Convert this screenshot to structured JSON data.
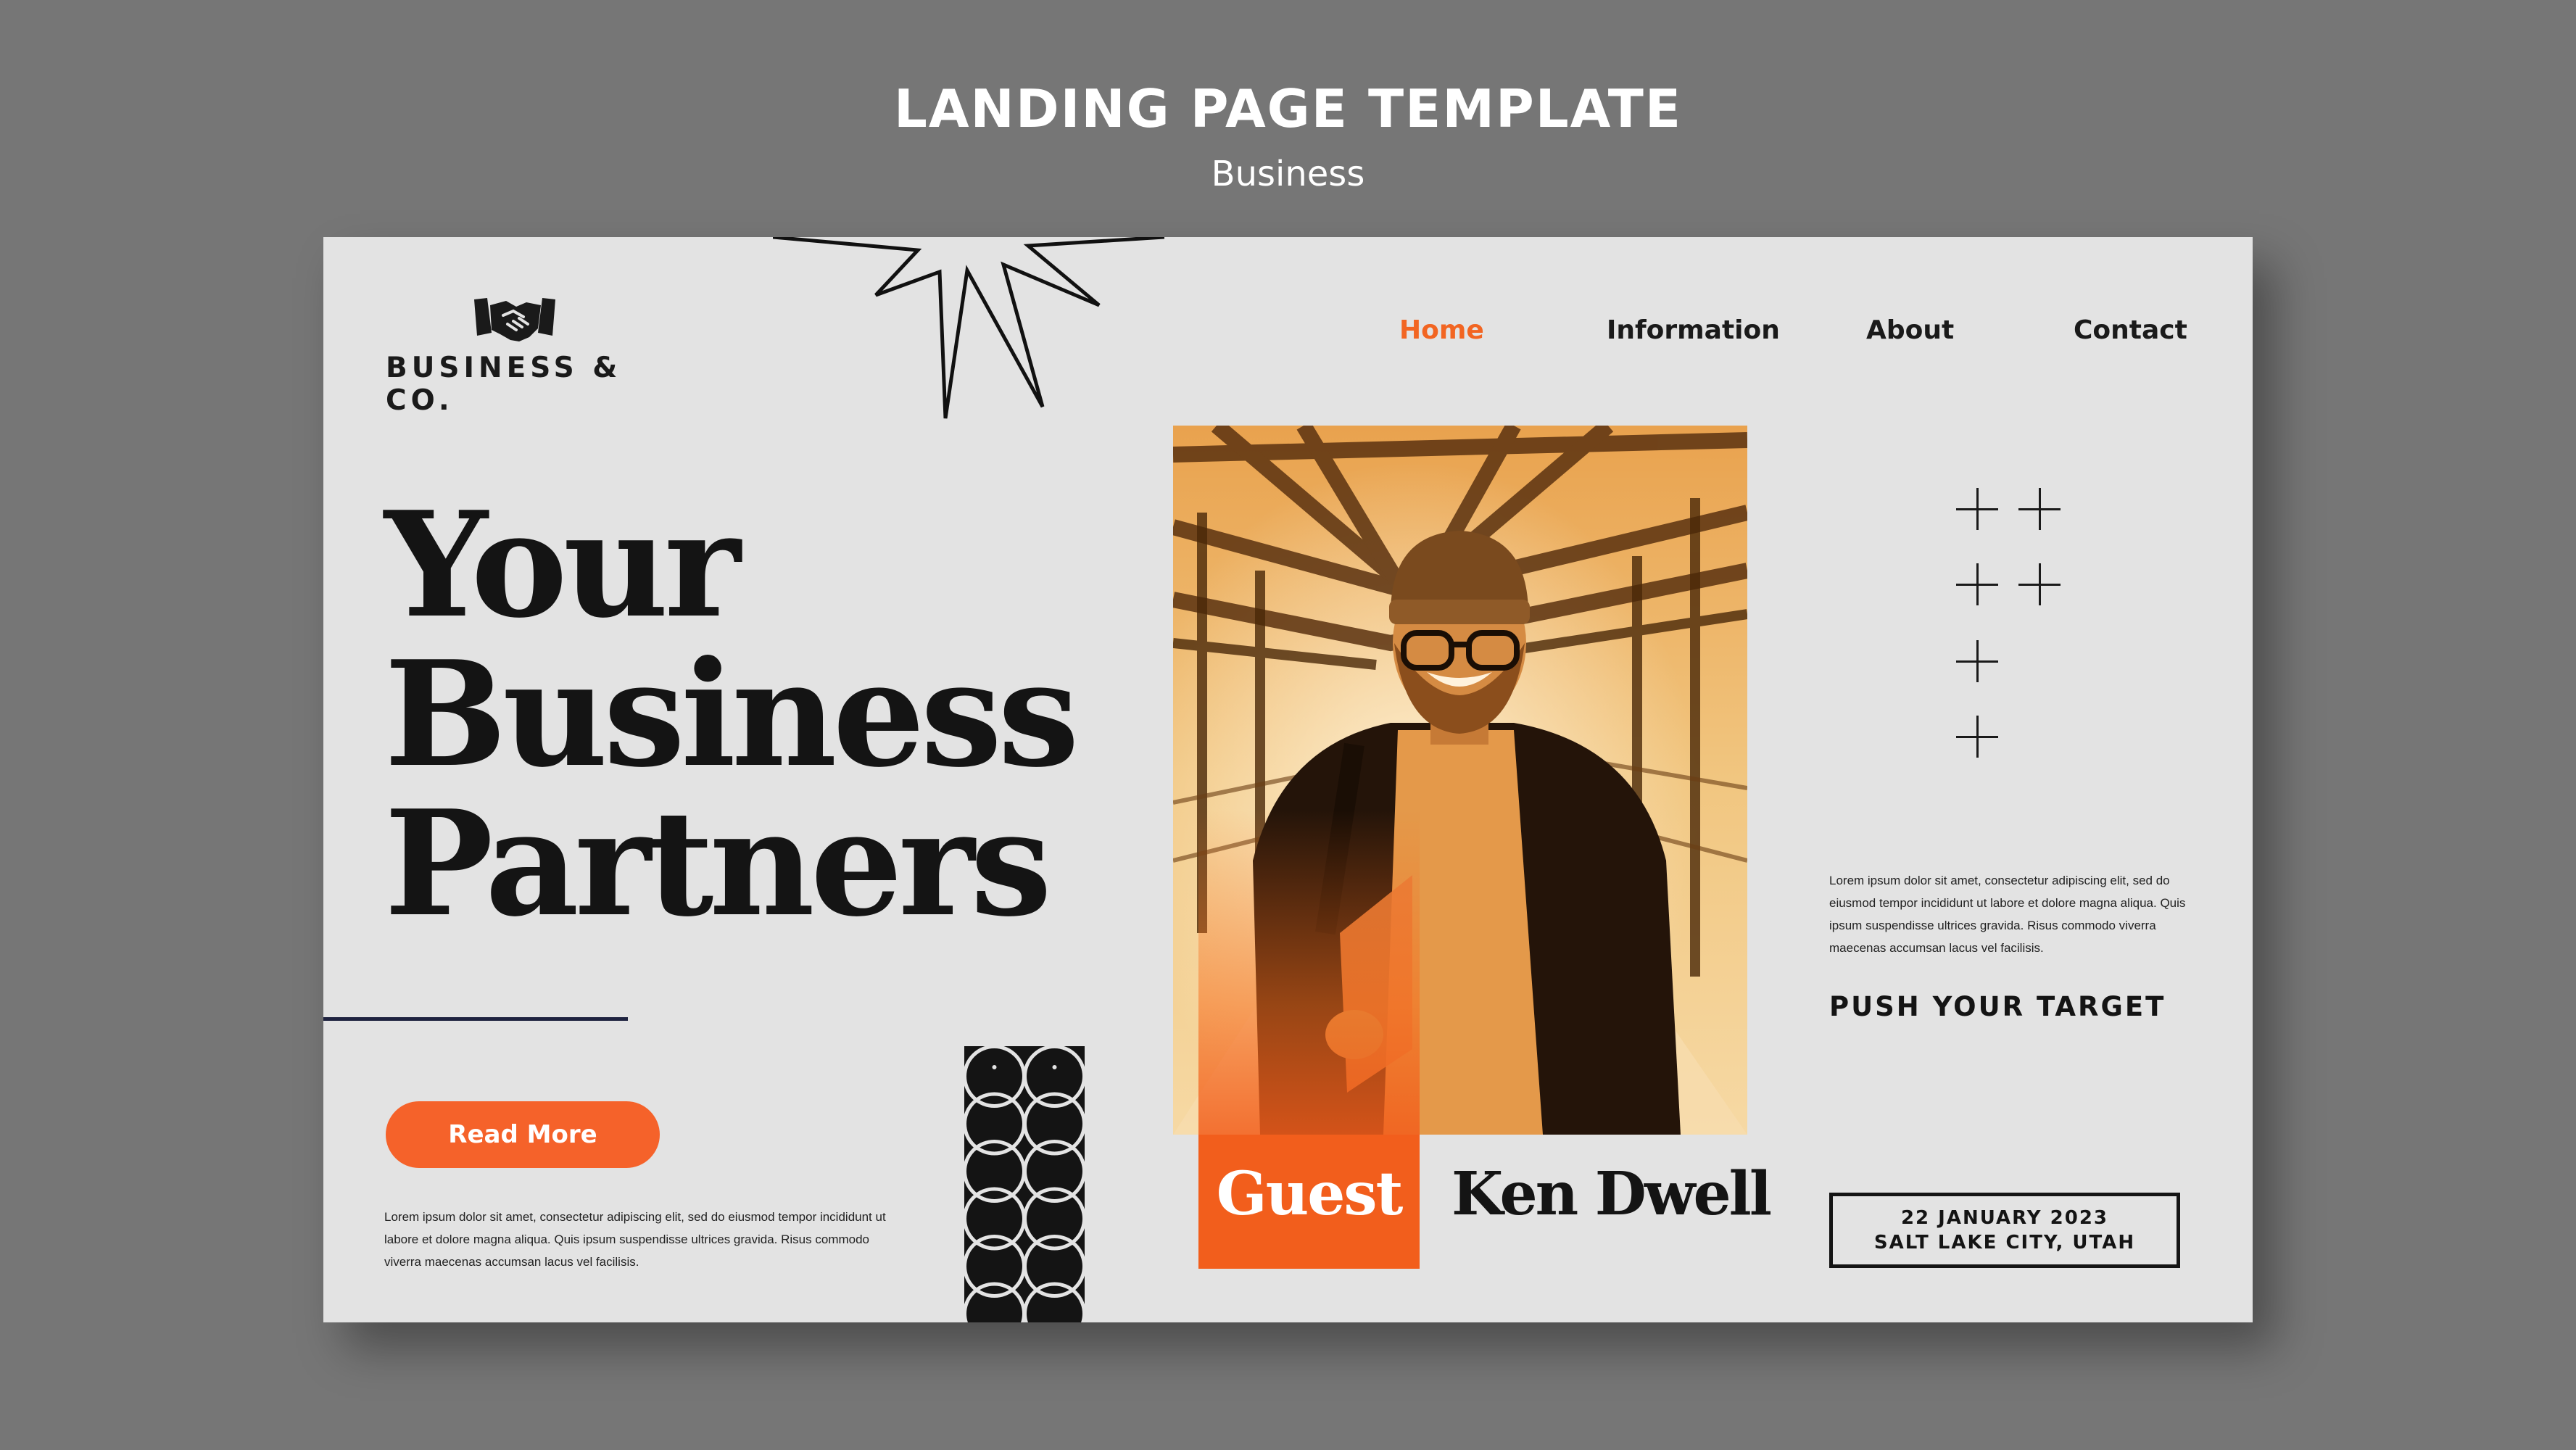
{
  "header": {
    "title": "LANDING PAGE TEMPLATE",
    "subtitle": "Business"
  },
  "logo": {
    "icon": "handshake-icon",
    "text": "BUSINESS & CO."
  },
  "nav": {
    "items": [
      {
        "label": "Home",
        "active": true
      },
      {
        "label": "Information",
        "active": false
      },
      {
        "label": "About",
        "active": false
      },
      {
        "label": "Contact",
        "active": false
      }
    ]
  },
  "hero": {
    "title_lines": [
      "Your",
      "Business",
      "Partners"
    ],
    "cta_label": "Read More",
    "body": "Lorem ipsum dolor sit amet, consectetur adipiscing elit, sed do eiusmod tempor incididunt ut labore et dolore magna aliqua. Quis ipsum suspendisse ultrices gravida. Risus commodo viverra maecenas accumsan lacus vel facilisis."
  },
  "guest": {
    "label": "Guest",
    "name": "Ken Dwell"
  },
  "side": {
    "body": "Lorem ipsum dolor sit amet, consectetur adipiscing elit, sed do eiusmod tempor incididunt ut labore et dolore magna aliqua. Quis ipsum suspendisse ultrices gravida. Risus commodo viverra maecenas accumsan lacus vel facilisis.",
    "tagline": "PUSH YOUR TARGET",
    "event_date": "22 JANUARY 2023",
    "event_location": "SALT LAKE CITY, UTAH"
  },
  "colors": {
    "accent": "#f5622a",
    "background": "#767676",
    "card": "#e3e3e3",
    "text": "#141414"
  }
}
